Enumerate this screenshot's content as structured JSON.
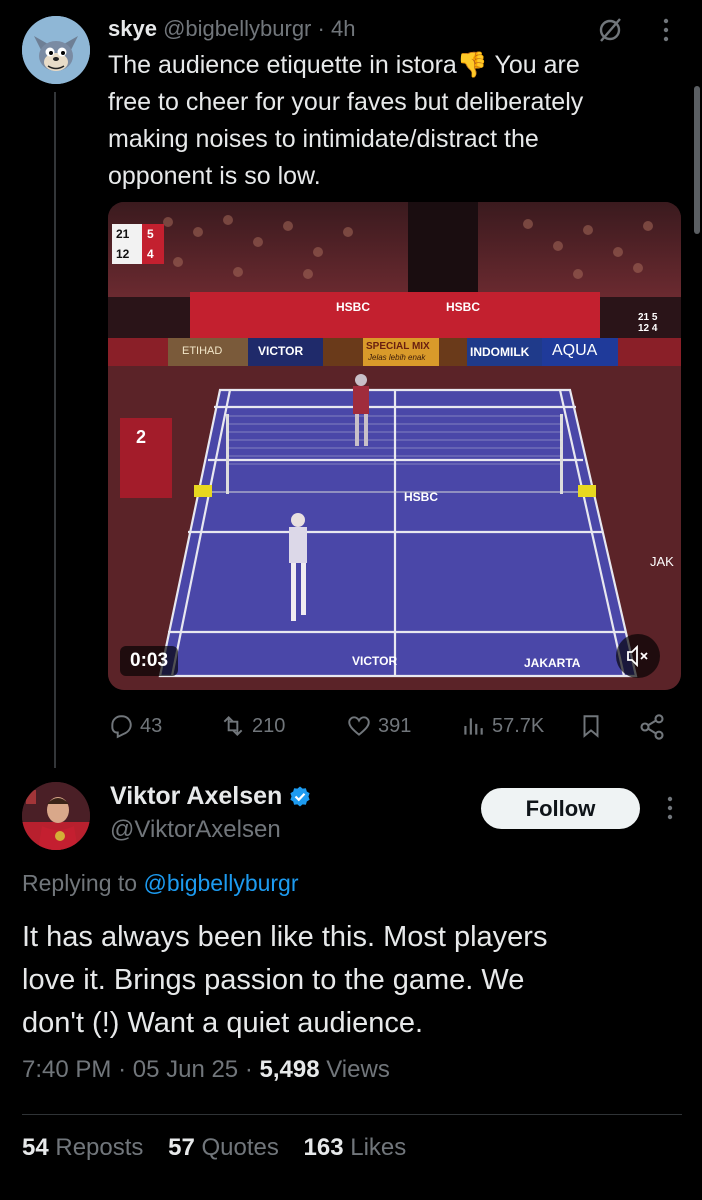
{
  "parent_tweet": {
    "display_name": "skye",
    "handle": "@bigbellyburgr",
    "separator": "·",
    "age": "4h",
    "text_line1": "The audience etiquette in istora👎 You are",
    "text_line2": "free to cheer for your faves but deliberately",
    "text_line3": "making noises to intimidate/distract the",
    "text_line4": "opponent is so low.",
    "video": {
      "elapsed": "0:03",
      "scoreboard_top": [
        "21",
        "5"
      ],
      "scoreboard_bottom": [
        "12",
        "4"
      ],
      "court_score_top": [
        "21",
        "5"
      ],
      "court_score_bottom": [
        "12",
        "4"
      ],
      "banner_sponsors": [
        "HSBC",
        "HSBC"
      ],
      "ad_boards": [
        "ETIHAD",
        "VICTOR",
        "SPECIAL MIX",
        "INDOMILK",
        "AQUA"
      ],
      "ad_tagline": "Jelas lebih enak",
      "court_logo": "HSBC",
      "court_bottom_left": "VICTOR",
      "court_bottom_right": "JAKARTA",
      "umpire_number": "2",
      "side_text": "JAK"
    },
    "actions": {
      "replies": "43",
      "reposts": "210",
      "likes": "391",
      "views": "57.7K"
    }
  },
  "reply_tweet": {
    "display_name": "Viktor Axelsen",
    "handle": "@ViktorAxelsen",
    "follow_label": "Follow",
    "replying_prefix": "Replying to",
    "replying_handle": "@bigbellyburgr",
    "text_line1": "It has always been like this. Most players",
    "text_line2": "love it. Brings passion to the game. We",
    "text_line3": "don't (!) Want a quiet audience.",
    "time": "7:40 PM",
    "date": "05 Jun 25",
    "dot": "·",
    "views_count": "5,498",
    "views_label": "Views",
    "reposts_count": "54",
    "reposts_label": "Reposts",
    "quotes_count": "57",
    "quotes_label": "Quotes",
    "likes_count": "163",
    "likes_label": "Likes"
  },
  "colors": {
    "background": "#000000",
    "text_primary": "#e7e9ea",
    "text_secondary": "#71767b",
    "link": "#1d9bf0",
    "court": "#4a47a8"
  }
}
